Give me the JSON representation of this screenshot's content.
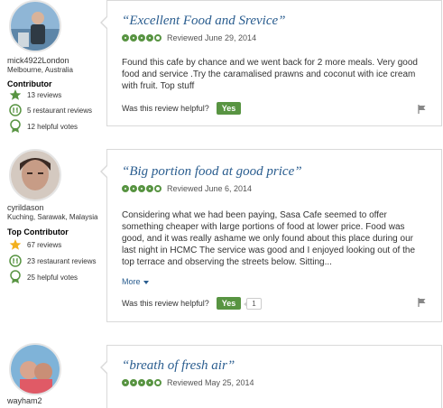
{
  "colors": {
    "accent_green": "#589442",
    "link_blue": "#2a5d8f",
    "border": "#d9d9d9"
  },
  "reviews": [
    {
      "user": {
        "username": "mick4922London",
        "location": "Melbourne, Australia",
        "contributor_title": "Contributor",
        "reviews_count": "13 reviews",
        "restaurant_reviews": "5 restaurant reviews",
        "helpful_votes": "12 helpful votes"
      },
      "title": "“Excellent Food and Srevice”",
      "rating": 4,
      "reviewed": "Reviewed June 29, 2014",
      "text": "Found this cafe by chance and we went back for 2 more meals. Very good food and service .Try the caramalised prawns and coconut with ice cream with fruit. Top stuff",
      "helpful_question": "Was this review helpful?",
      "yes_label": "Yes"
    },
    {
      "user": {
        "username": "cyrildason",
        "location": "Kuching, Sarawak, Malaysia",
        "contributor_title": "Top Contributor",
        "reviews_count": "67 reviews",
        "restaurant_reviews": "23 restaurant reviews",
        "helpful_votes": "25 helpful votes"
      },
      "title": "“Big portion food at good price”",
      "rating": 4,
      "reviewed": "Reviewed June 6, 2014",
      "text": "Considering what we had been paying, Sasa Cafe seemed to offer something cheaper with large portions of food at lower price. Food was good, and it was really ashame we only found about this place during our last night in HCMC The service was good and I enjoyed looking out of the top terrace and observing the streets below. Sitting...",
      "more_label": "More",
      "helpful_question": "Was this review helpful?",
      "yes_label": "Yes",
      "helpful_count": "1"
    },
    {
      "user": {
        "username": "wayham2"
      },
      "title": "“breath of fresh air”",
      "rating": 4,
      "reviewed": "Reviewed May 25, 2014"
    }
  ]
}
